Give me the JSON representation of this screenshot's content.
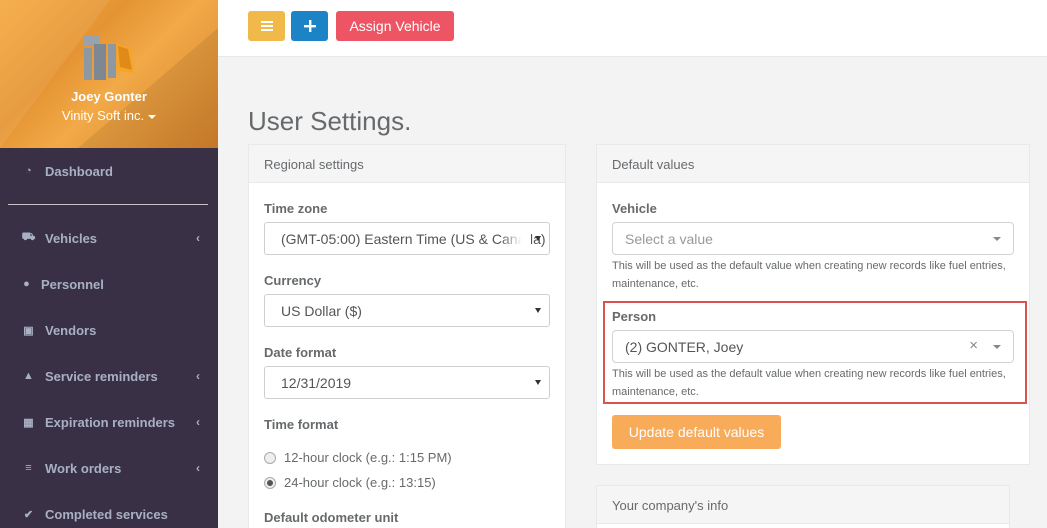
{
  "profile": {
    "name": "Joey Gonter",
    "company": "Vinity Soft inc."
  },
  "sidebar": {
    "items": [
      {
        "label": "Dashboard",
        "icon": "dashboard-icon",
        "has_submenu": false
      },
      {
        "label": "Vehicles",
        "icon": "truck-icon",
        "has_submenu": true
      },
      {
        "label": "Personnel",
        "icon": "user-icon",
        "has_submenu": false
      },
      {
        "label": "Vendors",
        "icon": "briefcase-icon",
        "has_submenu": false
      },
      {
        "label": "Service reminders",
        "icon": "warning-icon",
        "has_submenu": true
      },
      {
        "label": "Expiration reminders",
        "icon": "calendar-icon",
        "has_submenu": true
      },
      {
        "label": "Work orders",
        "icon": "tasks-icon",
        "has_submenu": true
      },
      {
        "label": "Completed services",
        "icon": "check-icon",
        "has_submenu": false
      }
    ]
  },
  "toolbar": {
    "menu_icon": "bars-icon",
    "add_label": "+",
    "assign_label": "Assign Vehicle"
  },
  "page": {
    "title": "User Settings."
  },
  "regional": {
    "header": "Regional settings",
    "timezone_label": "Time zone",
    "timezone_value": "(GMT-05:00) Eastern Time (US & Canada)",
    "currency_label": "Currency",
    "currency_value": "US Dollar ($)",
    "date_format_label": "Date format",
    "date_format_value": "12/31/2019",
    "time_format_label": "Time format",
    "time_12_label": "12-hour clock (e.g.: 1:15 PM)",
    "time_24_label": "24-hour clock (e.g.: 13:15)",
    "time_selected": "24-hour",
    "odometer_label": "Default odometer unit"
  },
  "defaults": {
    "header": "Default values",
    "vehicle_label": "Vehicle",
    "vehicle_placeholder": "Select a value",
    "vehicle_hint": "This will be used as the default value when creating new records like fuel entries, maintenance, etc.",
    "person_label": "Person",
    "person_value": "(2) GONTER, Joey",
    "person_clear": "×",
    "person_hint": "This will be used as the default value when creating new records like fuel entries, maintenance, etc.",
    "update_label": "Update default values"
  },
  "company": {
    "header": "Your company's info"
  },
  "colors": {
    "sidebar": "#3a3045",
    "accent_yellow": "#f0b949",
    "accent_blue": "#1c84c6",
    "accent_red": "#ed5565",
    "accent_orange": "#f8ac59",
    "highlight": "#d9534f"
  }
}
